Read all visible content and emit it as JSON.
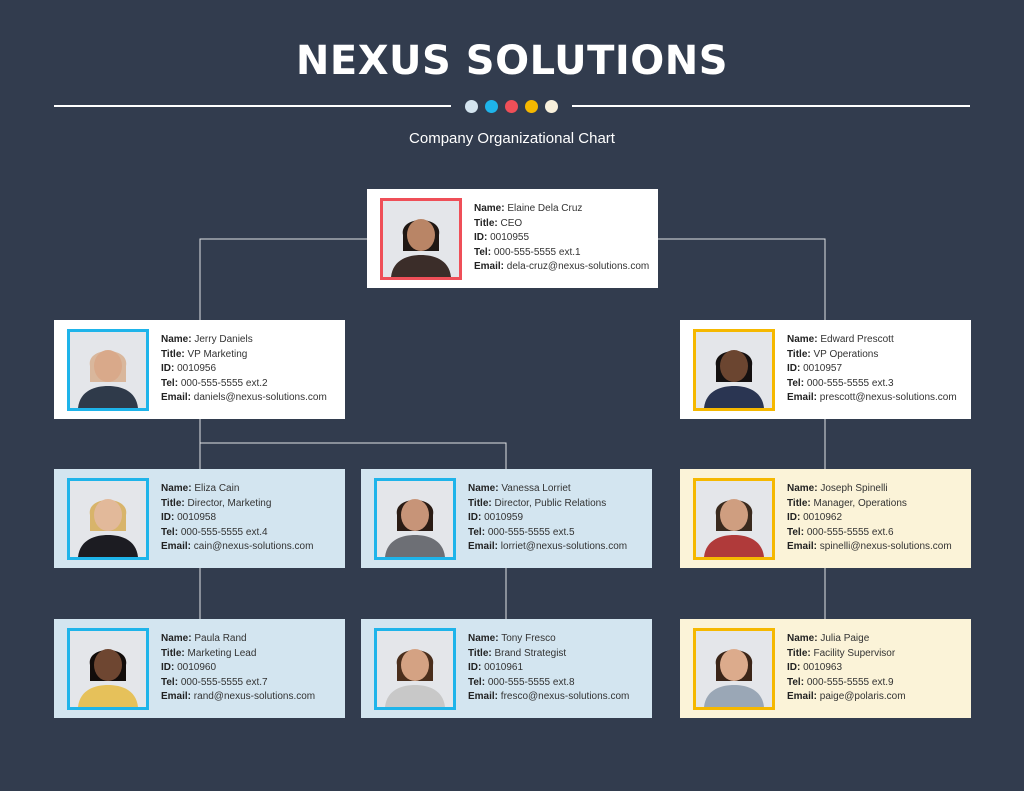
{
  "header": {
    "title": "NEXUS SOLUTIONS",
    "subtitle": "Company Organizational Chart",
    "dot_colors": [
      "#d4e4ef",
      "#1eb4ea",
      "#ef4f58",
      "#f5b800",
      "#f9f1dc"
    ]
  },
  "field_labels": {
    "name": "Name:",
    "title": "Title:",
    "id": "ID:",
    "tel": "Tel:",
    "email": "Email:"
  },
  "colors": {
    "background": "#323c4e",
    "frame_red": "#ef4f58",
    "frame_blue": "#1eb4ea",
    "frame_yellow": "#f5b800",
    "card_blue": "#d3e5f0",
    "card_cream": "#fbf3d8"
  },
  "employees": {
    "ceo": {
      "name": "Elaine Dela Cruz",
      "title": "CEO",
      "id": "0010955",
      "tel": "000-555-5555 ext.1",
      "email": "dela-cruz@nexus-solutions.com"
    },
    "vp_marketing": {
      "name": "Jerry Daniels",
      "title": "VP Marketing",
      "id": "0010956",
      "tel": "000-555-5555 ext.2",
      "email": "daniels@nexus-solutions.com"
    },
    "vp_operations": {
      "name": "Edward Prescott",
      "title": "VP Operations",
      "id": "0010957",
      "tel": "000-555-5555 ext.3",
      "email": "prescott@nexus-solutions.com"
    },
    "dir_marketing": {
      "name": "Eliza Cain",
      "title": "Director, Marketing",
      "id": "0010958",
      "tel": "000-555-5555 ext.4",
      "email": "cain@nexus-solutions.com"
    },
    "dir_pr": {
      "name": "Vanessa Lorriet",
      "title": "Director, Public Relations",
      "id": "0010959",
      "tel": "000-555-5555 ext.5",
      "email": "lorriet@nexus-solutions.com"
    },
    "mgr_operations": {
      "name": "Joseph Spinelli",
      "title": "Manager, Operations",
      "id": "0010962",
      "tel": "000-555-5555 ext.6",
      "email": "spinelli@nexus-solutions.com"
    },
    "marketing_lead": {
      "name": "Paula Rand",
      "title": "Marketing Lead",
      "id": "0010960",
      "tel": "000-555-5555 ext.7",
      "email": "rand@nexus-solutions.com"
    },
    "brand_strategist": {
      "name": "Tony Fresco",
      "title": "Brand Strategist",
      "id": "0010961",
      "tel": "000-555-5555 ext.8",
      "email": "fresco@nexus-solutions.com"
    },
    "facility_supervisor": {
      "name": "Julia Paige",
      "title": "Facility Supervisor",
      "id": "0010963",
      "tel": "000-555-5555 ext.9",
      "email": "paige@polaris.com"
    }
  }
}
